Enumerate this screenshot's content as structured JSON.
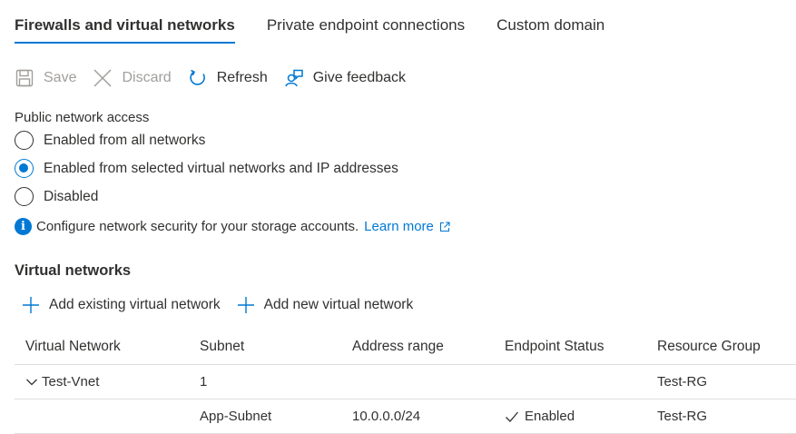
{
  "tabs": [
    {
      "label": "Firewalls and virtual networks",
      "active": true
    },
    {
      "label": "Private endpoint connections",
      "active": false
    },
    {
      "label": "Custom domain",
      "active": false
    }
  ],
  "toolbar": {
    "save_label": "Save",
    "discard_label": "Discard",
    "refresh_label": "Refresh",
    "feedback_label": "Give feedback"
  },
  "public_access": {
    "label": "Public network access",
    "options": [
      {
        "label": "Enabled from all networks",
        "selected": false
      },
      {
        "label": "Enabled from selected virtual networks and IP addresses",
        "selected": true
      },
      {
        "label": "Disabled",
        "selected": false
      }
    ]
  },
  "info": {
    "text": "Configure network security for your storage accounts.",
    "link_label": "Learn more"
  },
  "virtual_networks": {
    "heading": "Virtual networks",
    "add_existing_label": "Add existing virtual network",
    "add_new_label": "Add new virtual network",
    "columns": [
      "Virtual Network",
      "Subnet",
      "Address range",
      "Endpoint Status",
      "Resource Group"
    ],
    "rows": [
      {
        "vnet": "Test-Vnet",
        "subnet": "1",
        "address": "",
        "status": "",
        "rg": "Test-RG",
        "expandable": true
      },
      {
        "vnet": "",
        "subnet": "App-Subnet",
        "address": "10.0.0.0/24",
        "status": "Enabled",
        "rg": "Test-RG",
        "expandable": false
      }
    ]
  },
  "colors": {
    "accent": "#0078d4",
    "text": "#323130",
    "disabled": "#a19f9d",
    "divider": "#e1dfdd"
  }
}
